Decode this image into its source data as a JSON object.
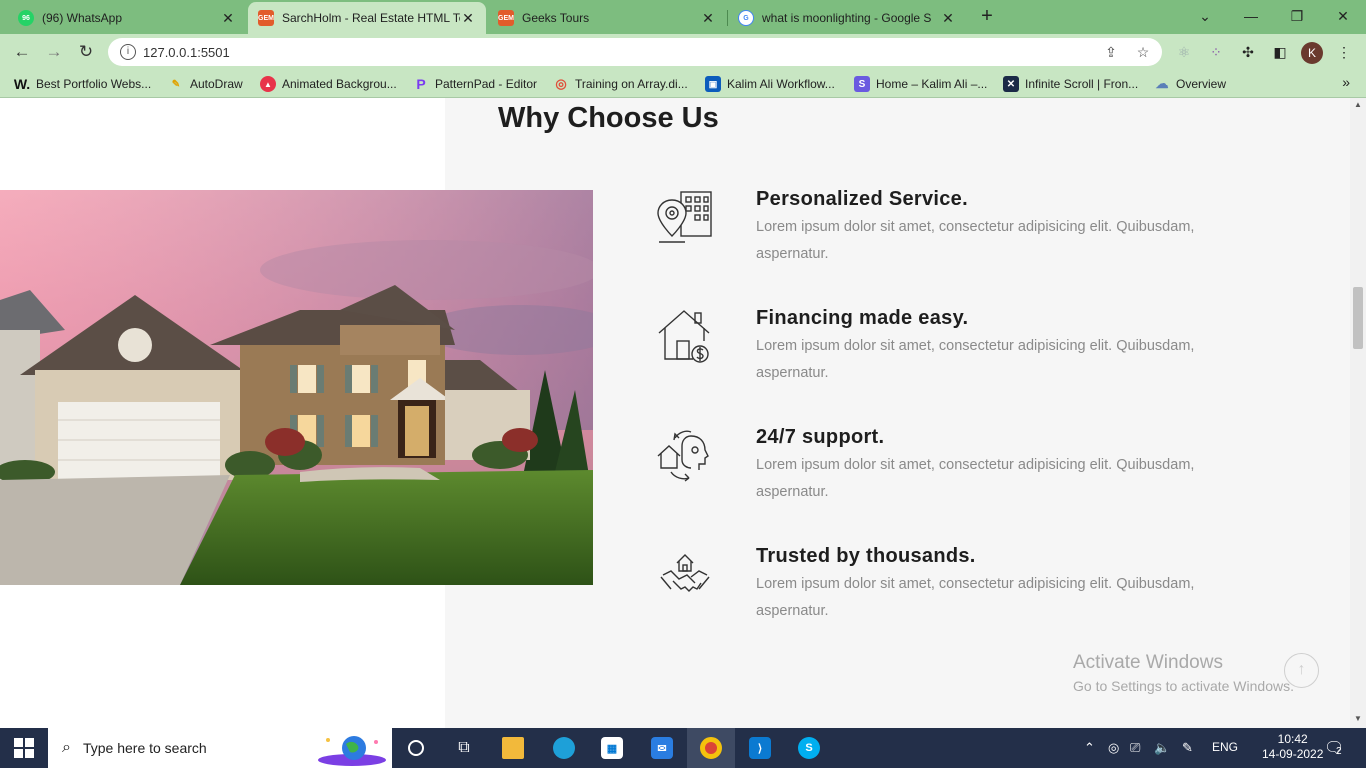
{
  "browser": {
    "tabs": [
      {
        "title": "(96) WhatsApp",
        "favicon_color": "#25d366",
        "favicon_text": "96"
      },
      {
        "title": "SarchHolm - Real Estate HTML Te",
        "favicon_color": "#e25c2b",
        "favicon_text": "GEM"
      },
      {
        "title": "Geeks Tours",
        "favicon_color": "#e25c2b",
        "favicon_text": "GEM"
      },
      {
        "title": "what is moonlighting - Google S",
        "favicon_color": "#4285f4",
        "favicon_text": "G"
      }
    ],
    "active_tab_index": 1,
    "url": "127.0.0.1:5501",
    "profile_initial": "K",
    "bookmarks": [
      {
        "label": "Best Portfolio Webs...",
        "icon": "W",
        "color": "#111111"
      },
      {
        "label": "AutoDraw",
        "icon": "✎",
        "color": "#f2b400"
      },
      {
        "label": "Animated Backgrou...",
        "icon": "▲",
        "color": "#e8334a"
      },
      {
        "label": "PatternPad - Editor",
        "icon": "P",
        "color": "#7a3cf0"
      },
      {
        "label": "Training on Array.di...",
        "icon": "◎",
        "color": "#e0503b"
      },
      {
        "label": "Kalim Ali Workflow...",
        "icon": "▣",
        "color": "#0c5cbc"
      },
      {
        "label": "Home – Kalim Ali –...",
        "icon": "S",
        "color": "#6a5ae0"
      },
      {
        "label": "Infinite Scroll | Fron...",
        "icon": "✕",
        "color": "#1b2a47"
      },
      {
        "label": "Overview",
        "icon": "☁",
        "color": "#5b7fb8"
      }
    ]
  },
  "page": {
    "section_heading": "Why Choose Us",
    "features": [
      {
        "title": "Personalized Service.",
        "description": "Lorem ipsum dolor sit amet, consectetur adipisicing elit. Quibusdam, aspernatur.",
        "icon": "building-map-pin-icon"
      },
      {
        "title": "Financing made easy.",
        "description": "Lorem ipsum dolor sit amet, consectetur adipisicing elit. Quibusdam, aspernatur.",
        "icon": "house-dollar-icon"
      },
      {
        "title": "24/7 support.",
        "description": "Lorem ipsum dolor sit amet, consectetur adipisicing elit. Quibusdam, aspernatur.",
        "icon": "support-agent-icon"
      },
      {
        "title": "Trusted by thousands.",
        "description": "Lorem ipsum dolor sit amet, consectetur adipisicing elit. Quibusdam, aspernatur.",
        "icon": "handshake-house-icon"
      }
    ],
    "watermark": {
      "line1": "Activate Windows",
      "line2": "Go to Settings to activate Windows."
    }
  },
  "taskbar": {
    "search_placeholder": "Type here to search",
    "language": "ENG",
    "time": "10:42",
    "date": "14-09-2022",
    "notification_count": "2"
  }
}
